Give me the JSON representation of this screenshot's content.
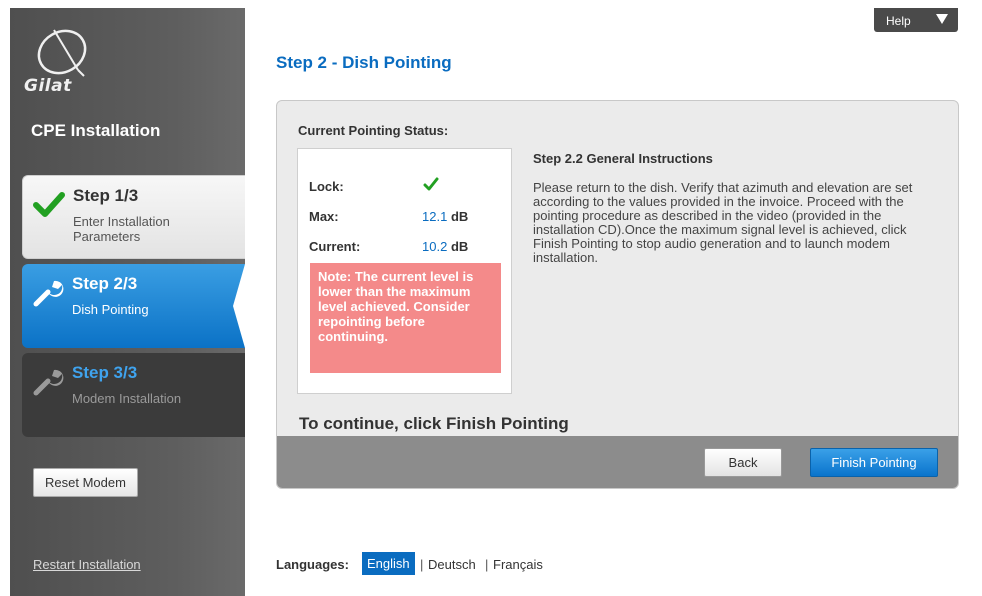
{
  "sidebar": {
    "logo_text": "Gilat",
    "title": "CPE Installation",
    "steps": [
      {
        "title": "Step 1/3",
        "subtitle": "Enter Installation Parameters",
        "status_icon": "check-icon"
      },
      {
        "title": "Step 2/3",
        "subtitle": "Dish Pointing",
        "status_icon": "wrench-icon"
      },
      {
        "title": "Step 3/3",
        "subtitle": "Modem Installation",
        "status_icon": "wrench-icon"
      }
    ],
    "reset_label": "Reset Modem",
    "restart_label": "Restart Installation"
  },
  "header": {
    "help_label": "Help"
  },
  "main": {
    "page_title": "Step 2 - Dish Pointing",
    "status": {
      "heading": "Current Pointing Status:",
      "lock_label": "Lock:",
      "lock_icon": "check-icon",
      "max_label": "Max:",
      "max_value": "12.1",
      "max_unit": "dB",
      "current_label": "Current:",
      "current_value": "10.2",
      "current_unit": "dB",
      "note": "Note: The current level is lower than the maximum level achieved. Consider repointing before continuing."
    },
    "instructions": {
      "heading": "Step 2.2 General Instructions",
      "body": "Please return to the dish. Verify that azimuth and elevation are set according to the values provided in the invoice. Proceed with the pointing procedure as described in the video (provided in the installation CD).Once the maximum signal level is achieved, click Finish Pointing to stop audio generation and to launch modem installation."
    },
    "continue_text": "To continue, click Finish Pointing",
    "back_label": "Back",
    "finish_label": "Finish Pointing"
  },
  "languages": {
    "label": "Languages:",
    "options": [
      "English",
      "Deutsch",
      "Français"
    ],
    "separator": "|",
    "selected": "English"
  },
  "colors": {
    "accent": "#0a6cc0",
    "step_active": "#1a86d6",
    "note_bg": "#f48a8a",
    "check_green": "#22a022"
  }
}
